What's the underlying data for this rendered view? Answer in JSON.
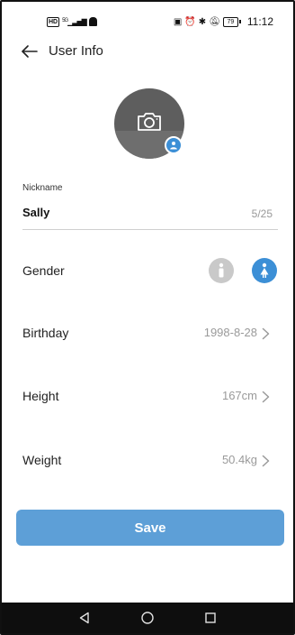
{
  "status_bar": {
    "hd_label": "HD",
    "signal_label": "5G",
    "battery_level": "79",
    "time": "11:12"
  },
  "header": {
    "title": "User Info",
    "back_icon": "back-arrow-icon"
  },
  "avatar": {
    "camera_icon": "camera-icon",
    "badge_icon": "user-icon"
  },
  "nickname": {
    "label": "Nickname",
    "value": "Sally",
    "counter": "5/25"
  },
  "gender": {
    "label": "Gender",
    "selected": "female",
    "options": [
      "male",
      "female"
    ]
  },
  "birthday": {
    "label": "Birthday",
    "value": "1998-8-28"
  },
  "height": {
    "label": "Height",
    "value": "167cm"
  },
  "weight": {
    "label": "Weight",
    "value": "50.4kg"
  },
  "save": {
    "label": "Save"
  },
  "colors": {
    "accent": "#3c8fd6",
    "save_button": "#5d9fd7",
    "avatar_bg": "#5e5e5e",
    "inactive_gender": "#c9c9c9",
    "nav_bar": "#0e0e0e"
  }
}
